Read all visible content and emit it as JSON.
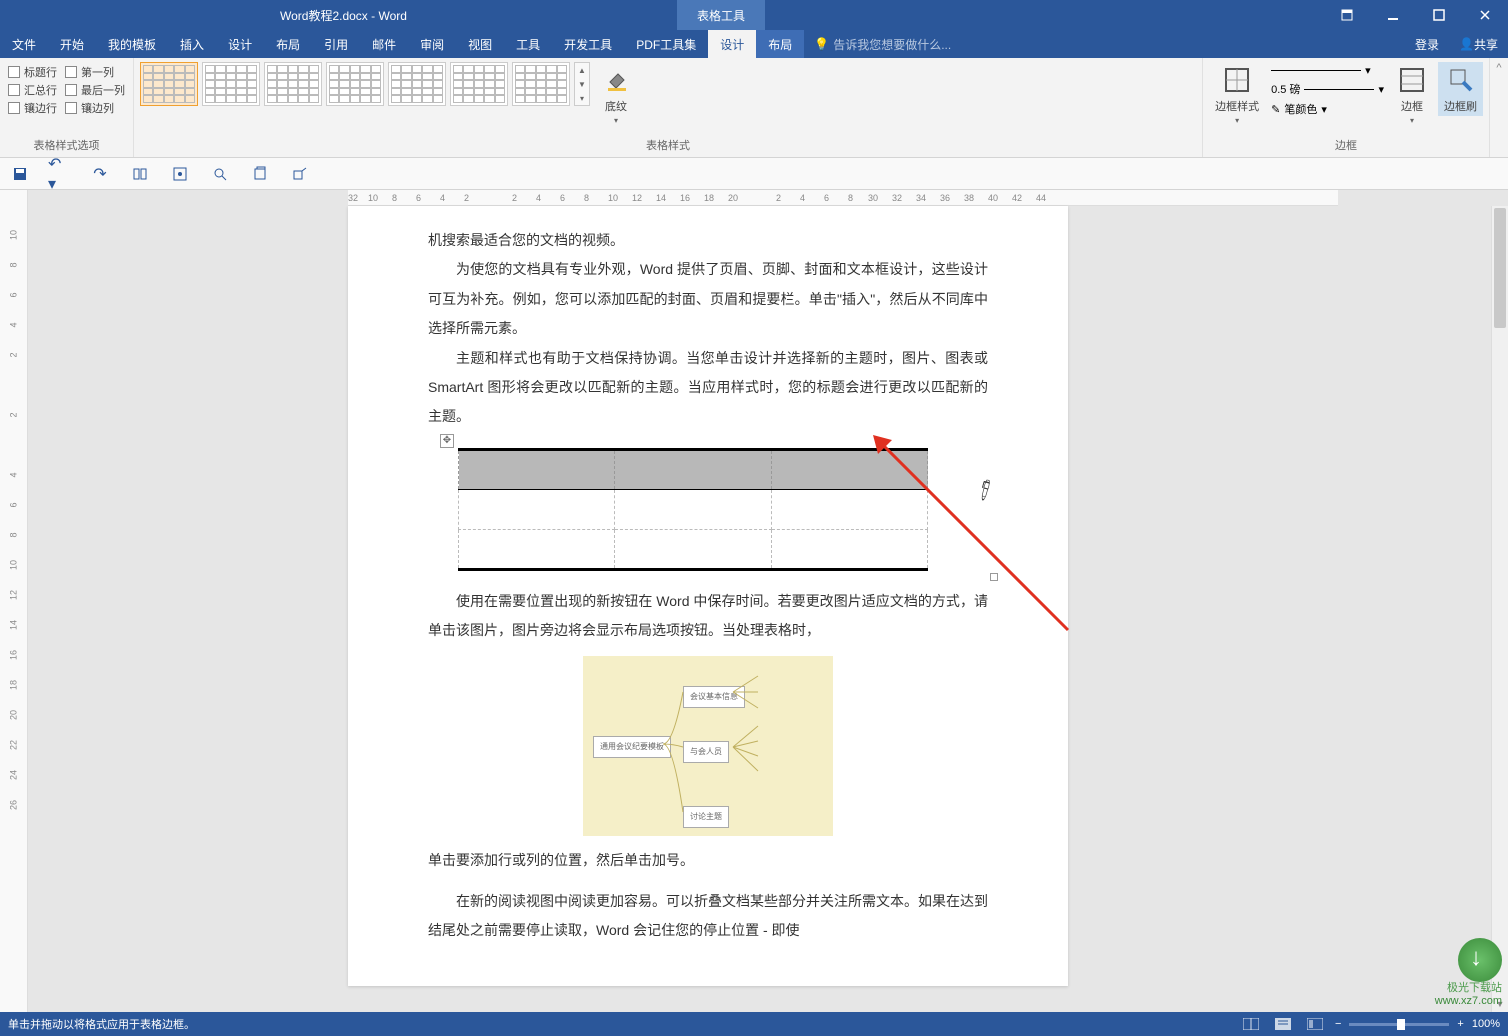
{
  "titlebar": {
    "document": "Word教程2.docx - Word",
    "tool_context": "表格工具"
  },
  "menu": {
    "file": "文件",
    "home": "开始",
    "templates": "我的模板",
    "insert": "插入",
    "design": "设计",
    "layout": "布局",
    "references": "引用",
    "mail": "邮件",
    "review": "审阅",
    "view": "视图",
    "tools": "工具",
    "devtools": "开发工具",
    "pdftools": "PDF工具集",
    "table_design": "设计",
    "table_layout": "布局",
    "tellme": "告诉我您想要做什么...",
    "login": "登录",
    "share": "共享"
  },
  "ribbon": {
    "style_options": {
      "header_row": "标题行",
      "first_col": "第一列",
      "total_row": "汇总行",
      "last_col": "最后一列",
      "banded_row": "镶边行",
      "banded_col": "镶边列",
      "group_label": "表格样式选项"
    },
    "table_styles": {
      "group_label": "表格样式"
    },
    "shading": {
      "label": "底纹"
    },
    "border_styles": {
      "label": "边框样式"
    },
    "borders": {
      "weight": "0.5 磅",
      "pen_color": "笔颜色",
      "border_btn": "边框",
      "painter_btn": "边框刷",
      "group_label": "边框"
    }
  },
  "doc": {
    "p1": "机搜索最适合您的文档的视频。",
    "p2": "为使您的文档具有专业外观，Word 提供了页眉、页脚、封面和文本框设计，这些设计可互为补充。例如，您可以添加匹配的封面、页眉和提要栏。单击\"插入\"，然后从不同库中选择所需元素。",
    "p3": "主题和样式也有助于文档保持协调。当您单击设计并选择新的主题时，图片、图表或 SmartArt 图形将会更改以匹配新的主题。当应用样式时，您的标题会进行更改以匹配新的主题。",
    "p4": "使用在需要位置出现的新按钮在 Word 中保存时间。若要更改图片适应文档的方式，请单击该图片，图片旁边将会显示布局选项按钮。当处理表格时，",
    "p5": "单击要添加行或列的位置，然后单击加号。",
    "p6": "在新的阅读视图中阅读更加容易。可以折叠文档某些部分并关注所需文本。如果在达到结尾处之前需要停止读取，Word 会记住您的停止位置 - 即使",
    "mindmap_root": "通用会议纪要模板"
  },
  "ruler": {
    "h": [
      "32",
      "10",
      "8",
      "6",
      "4",
      "2",
      "",
      "2",
      "4",
      "6",
      "8",
      "10",
      "12",
      "14",
      "16",
      "18",
      "20",
      "",
      "2",
      "4",
      "6",
      "8",
      "30",
      "32",
      "34",
      "36",
      "38",
      "40",
      "42",
      "44"
    ],
    "v": [
      "10",
      "8",
      "6",
      "4",
      "2",
      "",
      "2",
      "",
      "4",
      "6",
      "8",
      "10",
      "12",
      "14",
      "16",
      "18",
      "20",
      "22",
      "24",
      "26"
    ]
  },
  "statusbar": {
    "hint": "单击并拖动以将格式应用于表格边框。",
    "zoom": "100%"
  },
  "watermark": {
    "l1": "极光下载站",
    "l2": "www.xz7.com"
  }
}
